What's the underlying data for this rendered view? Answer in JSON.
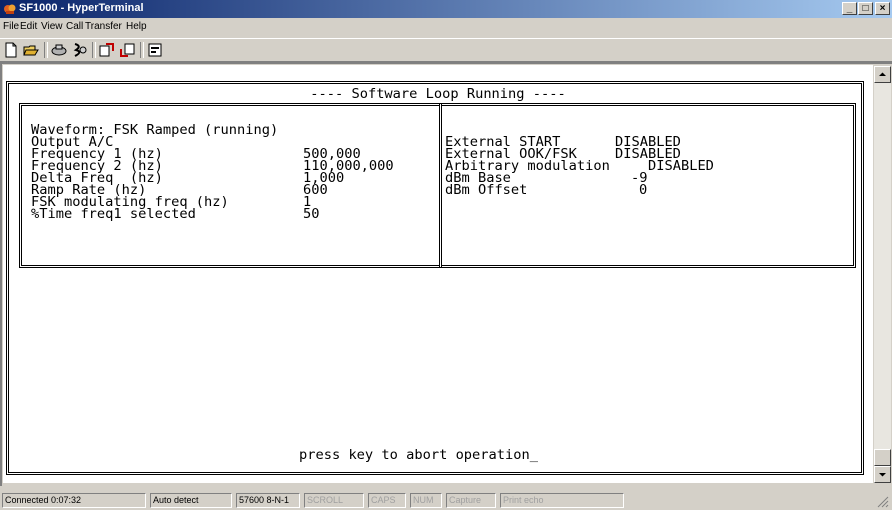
{
  "window": {
    "title": "SF1000 - HyperTerminal"
  },
  "menu": [
    "File",
    "Edit",
    "View",
    "Call",
    "Transfer",
    "Help"
  ],
  "toolbar": {
    "icons": [
      "new-icon",
      "open-icon",
      "connect-icon",
      "disconnect-icon",
      "send-icon",
      "receive-icon",
      "properties-icon"
    ]
  },
  "terminal": {
    "header": "---- Software Loop Running ----",
    "left": {
      "waveform": "Waveform: FSK Ramped (running)",
      "output": "Output A/C",
      "rows": [
        {
          "label": "Frequency 1 (hz)",
          "value": "500,000"
        },
        {
          "label": "Frequency 2 (hz)",
          "value": "110,000,000"
        },
        {
          "label": "Delta Freq  (hz)",
          "value": "1,000"
        },
        {
          "label": "Ramp Rate (hz)",
          "value": "600"
        },
        {
          "label": "FSK modulating freq (hz)",
          "value": "1"
        },
        {
          "label": "%Time freq1 selected",
          "value": "50"
        }
      ]
    },
    "right": {
      "rows": [
        {
          "label": "External START",
          "value": "DISABLED"
        },
        {
          "label": "External OOK/FSK",
          "value": "DISABLED"
        },
        {
          "label": "Arbitrary modulation",
          "value": "DISABLED"
        },
        {
          "label": "dBm Base",
          "value": "-9"
        },
        {
          "label": "dBm Offset",
          "value": "0"
        }
      ]
    },
    "prompt": "press key to abort operation_"
  },
  "statusbar": {
    "connected": "Connected 0:07:32",
    "detect": "Auto detect",
    "settings": "57600 8-N-1",
    "scroll": "SCROLL",
    "caps": "CAPS",
    "num": "NUM",
    "capture": "Capture",
    "print_echo": "Print echo"
  },
  "colors": {
    "titlebar_start": "#0a246a",
    "titlebar_end": "#a6caf0",
    "chrome": "#d4d0c8",
    "terminal_bg": "#ffffff"
  }
}
